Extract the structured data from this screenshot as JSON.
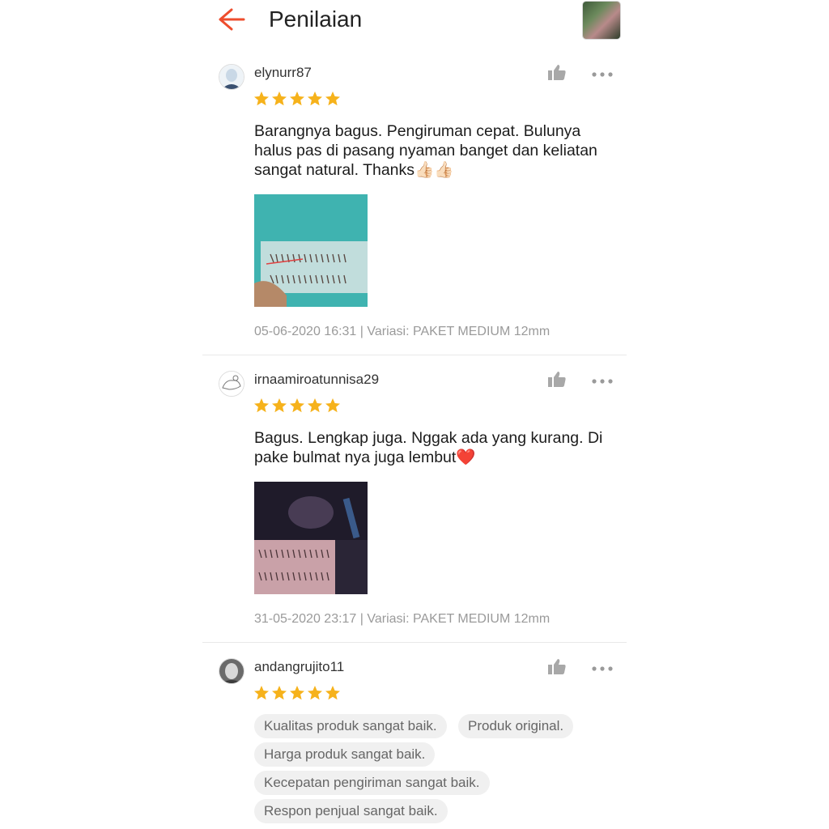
{
  "header": {
    "title": "Penilaian",
    "back_icon": "arrow-left-icon",
    "accent": "#ee4d2d"
  },
  "reviews": [
    {
      "username": "elynurr87",
      "rating": 5,
      "comment": "Barangnya bagus. Pengiruman cepat. Bulunya halus pas di pasang nyaman banget dan keliatan sangat natural. Thanks👍🏻👍🏻",
      "meta": "05-06-2020 16:31 | Variasi: PAKET MEDIUM 12mm"
    },
    {
      "username": "irnaamiroatunnisa29",
      "rating": 5,
      "comment": "Bagus. Lengkap juga. Nggak ada yang kurang. Di pake bulmat nya juga lembut❤️",
      "meta": "31-05-2020 23:17 | Variasi: PAKET MEDIUM 12mm"
    },
    {
      "username": "andangrujito11",
      "rating": 5,
      "tags": [
        "Kualitas produk sangat baik.",
        "Produk original.",
        "Harga produk sangat baik.",
        "Kecepatan pengiriman sangat baik.",
        "Respon penjual sangat baik."
      ]
    }
  ],
  "colors": {
    "star": "#f6b21b",
    "meta_text": "#9a9a9a",
    "tag_bg": "#f0f0f0"
  }
}
